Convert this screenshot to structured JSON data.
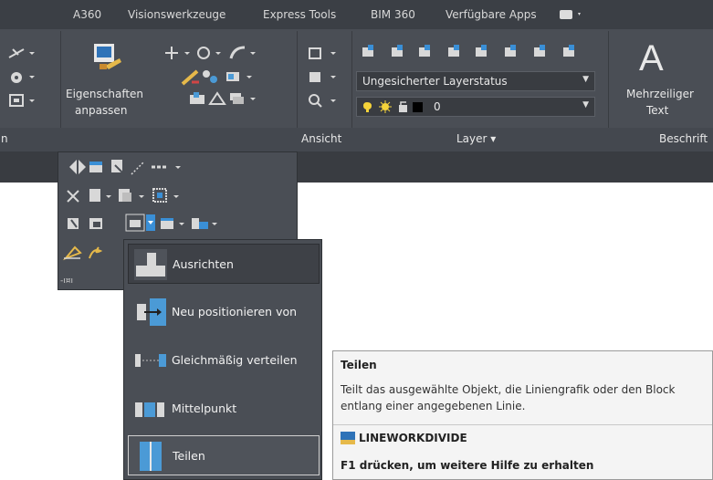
{
  "tabs": [
    "A360",
    "Visionswerkzeuge",
    "Express Tools",
    "BIM 360",
    "Verfügbare Apps"
  ],
  "ribbon": {
    "eigenschaften_label_1": "Eigenschaften",
    "eigenschaften_label_2": "anpassen",
    "layer_status_value": "Ungesicherter Layerstatus",
    "layer_current_value": "0",
    "mtext_label_1": "Mehrzeiliger",
    "mtext_label_2": "Text",
    "text_icon_glyph": "A",
    "panel_left_cut": "n",
    "panel_ansicht": "Ansicht",
    "panel_layer": "Layer ▾",
    "panel_beschrift": "Beschrift"
  },
  "modify_panel": {
    "pin_glyph": "-ı¤ı"
  },
  "flyout": {
    "items": [
      {
        "label": "Ausrichten"
      },
      {
        "label": "Neu positionieren von"
      },
      {
        "label": "Gleichmäßig verteilen"
      },
      {
        "label": "Mittelpunkt"
      },
      {
        "label": "Teilen"
      }
    ]
  },
  "tooltip": {
    "title": "Teilen",
    "description": "Teilt das ausgewählte Objekt, die Liniengrafik oder den Block entlang einer angegebenen Linie.",
    "command": "LINEWORKDIVIDE",
    "help": "F1 drücken, um weitere Hilfe zu erhalten"
  },
  "colors": {
    "ribbon_bg": "#4a4e55",
    "tabbar_bg": "#3b3f45",
    "tooltip_bg": "#f4f4f4",
    "accent_blue": "#3a8fd6",
    "layer_yellow": "#f5d33a"
  }
}
